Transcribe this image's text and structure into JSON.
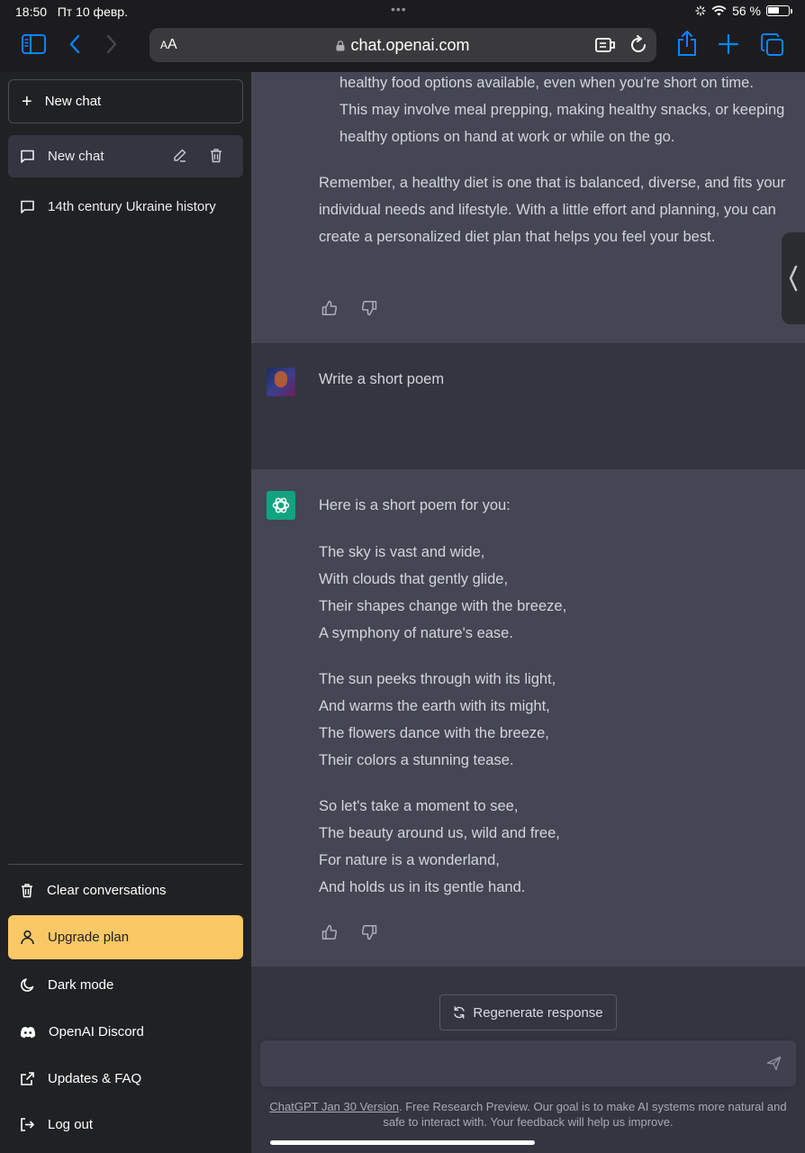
{
  "status_bar": {
    "time": "18:50",
    "date": "Пт 10 февр.",
    "battery": "56 %"
  },
  "browser": {
    "text_size_label_small": "A",
    "text_size_label_large": "A",
    "url": "chat.openai.com"
  },
  "sidebar": {
    "new_chat_label": "New chat",
    "conversations": [
      {
        "label": "New chat"
      },
      {
        "label": "14th century Ukraine history"
      }
    ],
    "items": [
      {
        "label": "Clear conversations"
      },
      {
        "label": "Upgrade plan"
      },
      {
        "label": "Dark mode"
      },
      {
        "label": "OpenAI Discord"
      },
      {
        "label": "Updates & FAQ"
      },
      {
        "label": "Log out"
      }
    ]
  },
  "thread": {
    "prev_list_item": "healthy food options available, even when you're short on time. This may involve meal prepping, making healthy snacks, or keeping healthy options on hand at work or while on the go.",
    "prev_closing": "Remember, a healthy diet is one that is balanced, diverse, and fits your individual needs and lifestyle. With a little effort and planning, you can create a personalized diet plan that helps you feel your best.",
    "user_prompt": "Write a short poem",
    "reply_intro": "Here is a short poem for you:",
    "poem": [
      [
        "The sky is vast and wide,",
        "With clouds that gently glide,",
        "Their shapes change with the breeze,",
        "A symphony of nature's ease."
      ],
      [
        "The sun peeks through with its light,",
        "And warms the earth with its might,",
        "The flowers dance with the breeze,",
        "Their colors a stunning tease."
      ],
      [
        "So let's take a moment to see,",
        "The beauty around us, wild and free,",
        "For nature is a wonderland,",
        "And holds us in its gentle hand."
      ]
    ]
  },
  "composer": {
    "regenerate_label": "Regenerate response",
    "input_value": "",
    "footer_link": "ChatGPT Jan 30 Version",
    "footer_text": ". Free Research Preview. Our goal is to make AI systems more natural and safe to interact with. Your feedback will help us improve."
  },
  "colors": {
    "sidebar_bg": "#202123",
    "main_bg": "#343541",
    "assistant_bg": "#444654",
    "upgrade_accent": "#fac864",
    "gpt_avatar": "#10a37f",
    "safari_accent": "#0a84ff"
  },
  "icons": {
    "toolbar": [
      "sidebar-toggle-icon",
      "back-icon",
      "forward-icon",
      "share-icon",
      "new-tab-icon",
      "tabs-icon",
      "reader-icon",
      "reload-icon",
      "lock-icon"
    ],
    "sidebar": [
      "plus-icon",
      "chat-bubble-icon",
      "edit-icon",
      "trash-icon",
      "user-icon",
      "moon-icon",
      "discord-icon",
      "external-link-icon",
      "logout-icon"
    ],
    "thread": [
      "thumbs-up-icon",
      "thumbs-down-icon",
      "openai-logo-icon",
      "refresh-icon",
      "send-icon"
    ]
  }
}
